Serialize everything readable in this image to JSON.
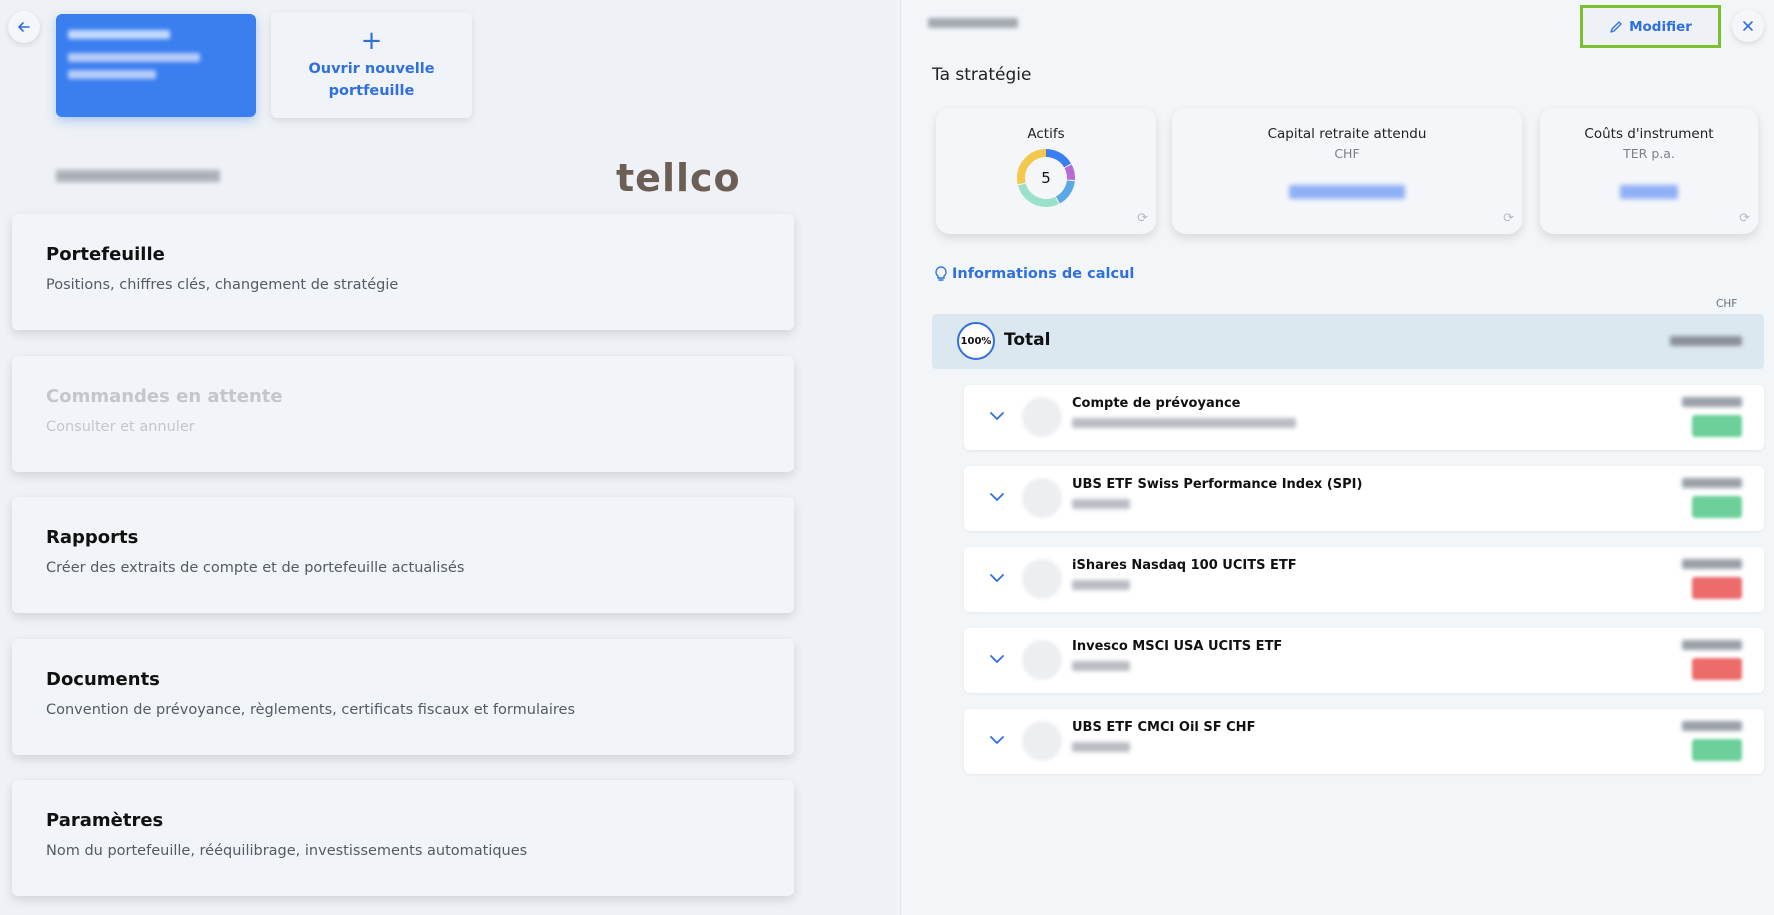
{
  "portfolio_switcher": {
    "new_portfolio_label_line1": "Ouvrir nouvelle",
    "new_portfolio_label_line2": "portfeuille",
    "plus_symbol": "+"
  },
  "brand": {
    "logo_text": "tellco"
  },
  "menu": [
    {
      "title": "Portefeuille",
      "subtitle": "Positions, chiffres clés, changement de stratégie"
    },
    {
      "title": "Commandes en attente",
      "subtitle": "Consulter et annuler"
    },
    {
      "title": "Rapports",
      "subtitle": "Créer des extraits de compte et de portefeuille actualisés"
    },
    {
      "title": "Documents",
      "subtitle": "Convention de prévoyance, règlements, certificats fiscaux et formulaires"
    },
    {
      "title": "Paramètres",
      "subtitle": "Nom du portefeuille, rééquilibrage, investissements automatiques"
    }
  ],
  "header": {
    "modify_label": "Modifier"
  },
  "strategy": {
    "title": "Ta stratégie",
    "kpis": {
      "assets_label": "Actifs",
      "assets_count": "5",
      "capital_label": "Capital retraite attendu",
      "capital_unit": "CHF",
      "costs_label": "Coûts d'instrument",
      "costs_unit": "TER p.a."
    },
    "info_link": "Informations de calcul",
    "currency_header": "CHF",
    "total": {
      "percent": "100%",
      "label": "Total"
    },
    "positions": [
      {
        "name": "Compte de prévoyance",
        "trend": "up"
      },
      {
        "name": "UBS ETF Swiss Performance Index (SPI)",
        "trend": "up"
      },
      {
        "name": "iShares Nasdaq 100 UCITS ETF",
        "trend": "down"
      },
      {
        "name": "Invesco MSCI USA UCITS ETF",
        "trend": "down"
      },
      {
        "name": "UBS ETF CMCI Oil SF CHF",
        "trend": "up"
      }
    ]
  },
  "colors": {
    "accent": "#2f6fe0",
    "highlight_border": "#7cc12c",
    "positive": "#6cd09a",
    "negative": "#ec6b6b"
  }
}
